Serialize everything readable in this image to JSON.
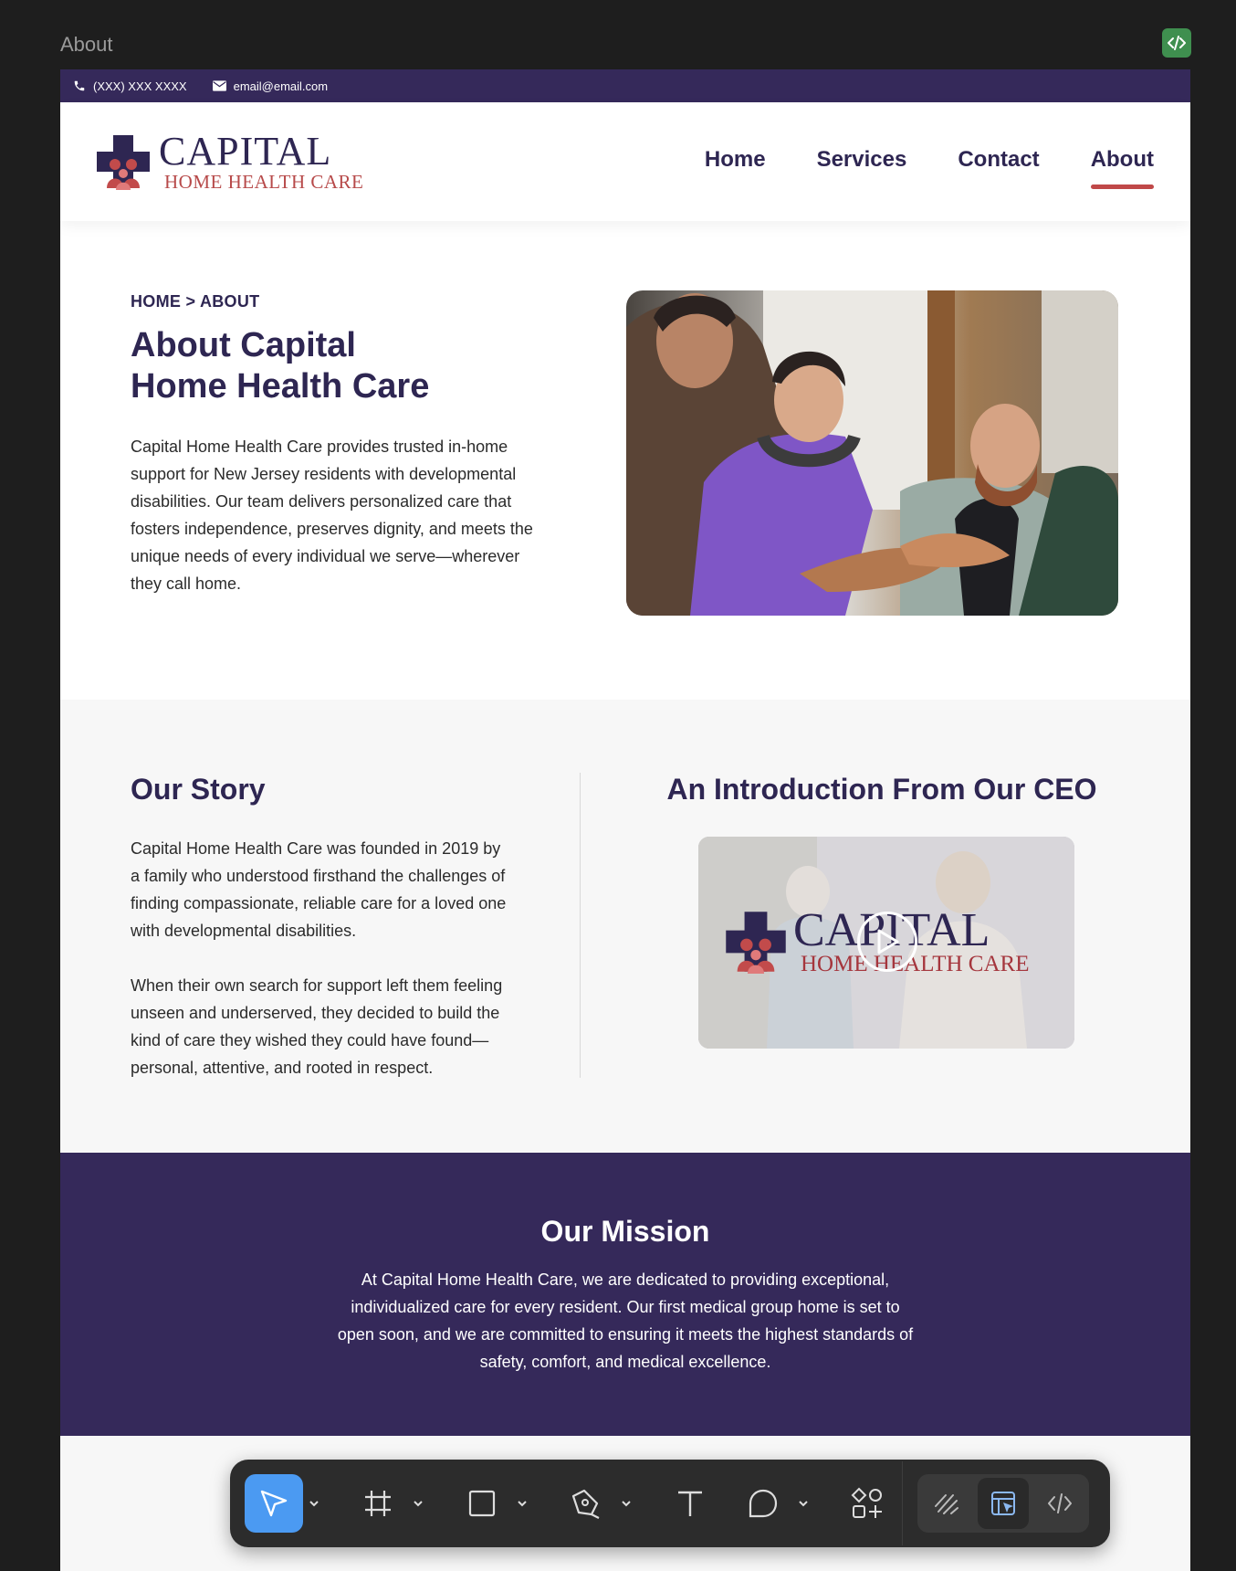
{
  "frame": {
    "label": "About"
  },
  "topbar": {
    "phone": "(XXX) XXX XXXX",
    "email": "email@email.com"
  },
  "logo": {
    "line1": "CAPITAL",
    "line2": "HOME HEALTH CARE"
  },
  "nav": [
    {
      "label": "Home",
      "active": false
    },
    {
      "label": "Services",
      "active": false
    },
    {
      "label": "Contact",
      "active": false
    },
    {
      "label": "About",
      "active": true
    }
  ],
  "hero": {
    "breadcrumb": "HOME > ABOUT",
    "title_line1": "About Capital",
    "title_line2": "Home Health Care",
    "text": "Capital Home Health Care provides trusted in-home support for New Jersey residents with developmental disabilities. Our team delivers personalized care that fosters independence, preserves dignity, and meets the unique needs of every individual we serve—wherever they call home."
  },
  "story": {
    "title": "Our Story",
    "p1": "Capital Home Health Care was founded in 2019 by a family who understood firsthand the challenges of finding compassionate, reliable care for a loved one with developmental disabilities.",
    "p2": "When their own search for support left them feeling unseen and underserved, they decided to build the kind of care they wished they could have found—personal, attentive, and rooted in respect."
  },
  "ceo": {
    "title": "An Introduction From Our CEO",
    "video_logo_line1": "CAPITAL",
    "video_logo_line2": "HOME HEALTH CARE"
  },
  "mission": {
    "title": "Our Mission",
    "text": "At Capital Home Health Care, we are dedicated to providing exceptional, individualized care for every resident. Our first medical group home is set to open soon, and we are committed to ensuring it meets the highest standards of safety, comfort, and medical excellence."
  },
  "colors": {
    "brand_purple": "#35295a",
    "brand_navy": "#2e2652",
    "brand_red": "#c04848",
    "toolbar_active": "#4b9af2"
  },
  "toolbar": {
    "tools": [
      "move-icon",
      "frame-icon",
      "rectangle-icon",
      "pen-icon",
      "text-icon",
      "comment-icon",
      "actions-icon"
    ],
    "right_tools": [
      "draw-icon",
      "design-icon",
      "dev-mode-icon"
    ]
  }
}
